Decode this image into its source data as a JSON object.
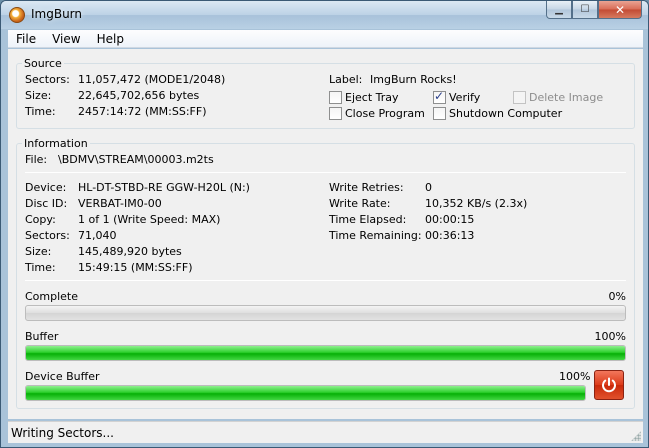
{
  "window": {
    "title": "ImgBurn"
  },
  "caption_buttons": {
    "minimize": "▁",
    "maximize": "☐",
    "close": "✕"
  },
  "menu": [
    "File",
    "View",
    "Help"
  ],
  "source": {
    "group_label": "Source",
    "sectors_label": "Sectors:",
    "sectors_value": "11,057,472 (MODE1/2048)",
    "size_label": "Size:",
    "size_value": "22,645,702,656 bytes",
    "time_label": "Time:",
    "time_value": "2457:14:72 (MM:SS:FF)",
    "label_label": "Label:",
    "label_value": "ImgBurn Rocks!",
    "options": {
      "eject_tray": {
        "label": "Eject Tray",
        "checked": false
      },
      "verify": {
        "label": "Verify",
        "checked": true
      },
      "delete_image": {
        "label": "Delete Image",
        "checked": false,
        "disabled": true
      },
      "close_program": {
        "label": "Close Program",
        "checked": false
      },
      "shutdown_computer": {
        "label": "Shutdown Computer",
        "checked": false
      }
    }
  },
  "information": {
    "group_label": "Information",
    "file_label": "File:",
    "file_value": "\\BDMV\\STREAM\\00003.m2ts",
    "device_label": "Device:",
    "device_value": "HL-DT-STBD-RE GGW-H20L (N:)",
    "discid_label": "Disc ID:",
    "discid_value": "VERBAT-IM0-00",
    "copy_label": "Copy:",
    "copy_value": "1 of 1 (Write Speed: MAX)",
    "sectors_label": "Sectors:",
    "sectors_value": "71,040",
    "size_label": "Size:",
    "size_value": "145,489,920 bytes",
    "time_label": "Time:",
    "time_value": "15:49:15 (MM:SS:FF)",
    "write_retries_label": "Write Retries:",
    "write_retries_value": "0",
    "write_rate_label": "Write Rate:",
    "write_rate_value": "10,352 KB/s (2.3x)",
    "time_elapsed_label": "Time Elapsed:",
    "time_elapsed_value": "00:00:15",
    "time_remaining_label": "Time Remaining:",
    "time_remaining_value": "00:36:13"
  },
  "progress": {
    "complete": {
      "label": "Complete",
      "percent_text": "0%",
      "fraction": 0.0
    },
    "buffer": {
      "label": "Buffer",
      "percent_text": "100%",
      "fraction": 1.0
    },
    "device_buffer": {
      "label": "Device Buffer",
      "percent_text": "100%",
      "fraction": 1.0
    }
  },
  "status": {
    "text": "Writing Sectors..."
  },
  "colors": {
    "progress_green": "#06b006",
    "stop_red": "#dc3a18",
    "accent": "#2a3f8a"
  },
  "icons": {
    "app": "imgburn-disc-icon",
    "stop": "power-icon"
  }
}
